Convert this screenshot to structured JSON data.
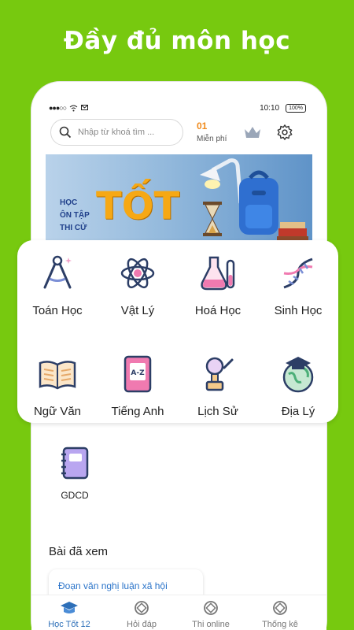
{
  "headline": "Đầy đủ môn học",
  "statusbar": {
    "time": "10:10",
    "battery": "100%"
  },
  "search": {
    "placeholder": "Nhập từ khoá tìm ..."
  },
  "free": {
    "count": "01",
    "label": "Miễn phí"
  },
  "banner": {
    "line1": "HỌC",
    "line2": "ÔN TẬP",
    "line3": "THI CỬ",
    "big": "TỐT"
  },
  "subjects": [
    {
      "label": "Toán Học",
      "icon": "compass-icon"
    },
    {
      "label": "Vật Lý",
      "icon": "atom-icon"
    },
    {
      "label": "Hoá Học",
      "icon": "flask-icon"
    },
    {
      "label": "Sinh Học",
      "icon": "dna-icon"
    },
    {
      "label": "Ngữ Văn",
      "icon": "open-book-icon"
    },
    {
      "label": "Tiếng Anh",
      "icon": "dictionary-icon"
    },
    {
      "label": "Lịch Sử",
      "icon": "lamp-icon"
    },
    {
      "label": "Địa Lý",
      "icon": "globe-icon"
    }
  ],
  "extra_subject": {
    "label": "GDCD",
    "icon": "notebook-icon"
  },
  "viewed": {
    "title": "Bài đã xem",
    "item": "Đoạn văn nghị luận xã hội"
  },
  "tabs": [
    {
      "label": "Học Tốt 12",
      "icon": "graduation-cap-icon"
    },
    {
      "label": "Hỏi đáp",
      "icon": "qa-icon"
    },
    {
      "label": "Thi online",
      "icon": "exam-icon"
    },
    {
      "label": "Thống kê",
      "icon": "stats-icon"
    }
  ],
  "colors": {
    "background": "#77c90f",
    "accent_orange": "#f08a1c",
    "tab_active": "#2d6fb8",
    "banner_text": "#f6a814"
  }
}
